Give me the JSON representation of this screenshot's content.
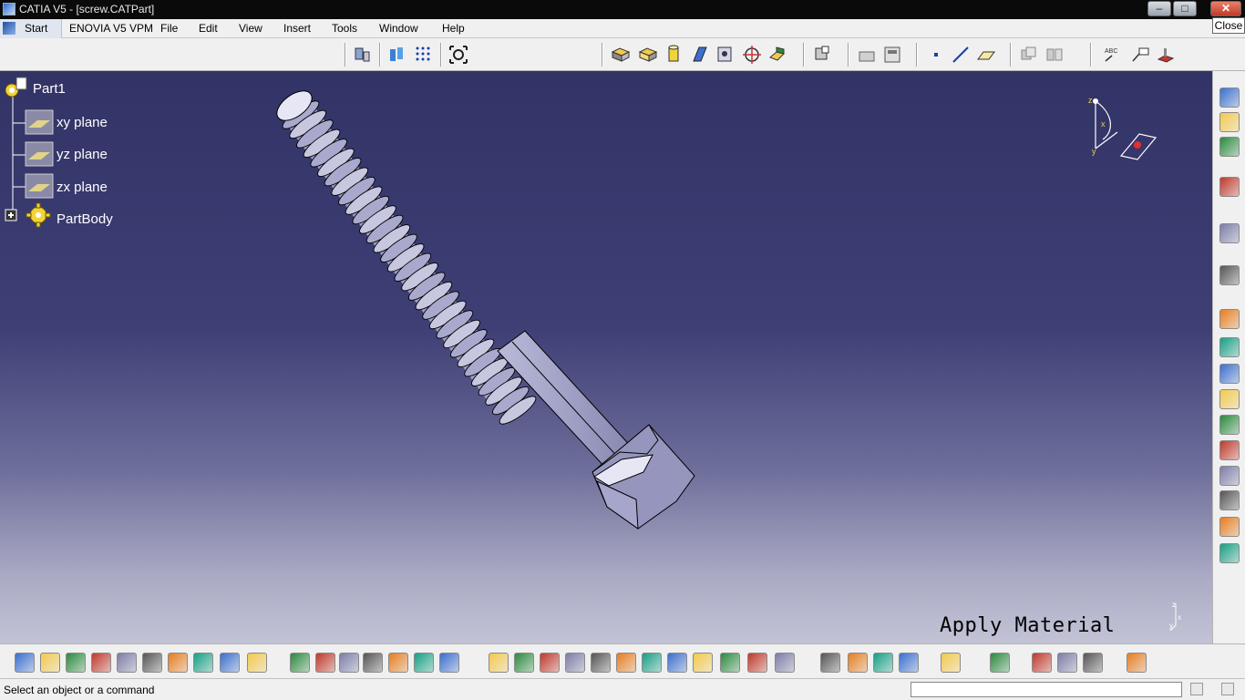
{
  "window": {
    "title": "CATIA V5 - [screw.CATPart]",
    "minimize_glyph": "–",
    "maximize_glyph": "□",
    "close_glyph": "✕",
    "close_tooltip": "Close"
  },
  "menu": {
    "start": "Start",
    "items": [
      "ENOVIA V5 VPM",
      "File",
      "Edit",
      "View",
      "Insert",
      "Tools",
      "Window",
      "Help"
    ]
  },
  "tree": {
    "root": "Part1",
    "planes": [
      "xy plane",
      "yz plane",
      "zx plane"
    ],
    "body": "PartBody"
  },
  "compass": {
    "z_label": "z",
    "x_label": "x",
    "y_label": "y"
  },
  "corner_axis": {
    "z_label": "z",
    "x_label": "x",
    "y_label": "y"
  },
  "viewport": {
    "overlay_text": "Apply Material",
    "bg_top": "#323366",
    "bg_bottom": "#c3c3d6",
    "part_color": "#9e9ec4"
  },
  "status": {
    "text": "Select an object or a command",
    "input_value": ""
  },
  "toolbars": {
    "top_icons": [
      "part-design-workbench-icon",
      "plane-manipulation-icon",
      "grid-icon",
      "fit-all-icon",
      "pad-icon",
      "pocket-icon",
      "shaft-icon",
      "rib-icon",
      "hole-icon",
      "groove-icon",
      "stiffener-icon",
      "thread-icon",
      "measure-icon",
      "tree-icon",
      "point-icon",
      "line-icon",
      "plane-icon",
      "boolean-icon",
      "symmetry-icon",
      "text-annotation-icon",
      "flag-note-icon",
      "material-icon"
    ],
    "right_icons": [
      "workbench-switch-icon",
      "product-icon",
      "assembly-icon",
      "gear-icon",
      "select-arrow-icon",
      "sketcher-icon",
      "pad-feature-icon",
      "pocket-feature-icon",
      "shaft-feature-icon",
      "groove-feature-icon",
      "hole-feature-icon",
      "rib-feature-icon",
      "slot-feature-icon",
      "stiffener-feature-icon",
      "loft-feature-icon",
      "remove-loft-icon"
    ],
    "bottom_icons": [
      "new-file-icon",
      "open-folder-icon",
      "save-icon",
      "print-icon",
      "cut-icon",
      "copy-icon",
      "paste-icon",
      "undo-icon",
      "redo-icon",
      "whats-this-icon",
      "formula-fx-icon",
      "knowledge-icon",
      "lightning-icon",
      "table-icon",
      "network-icon",
      "lock-icon",
      "catalog-icon",
      "fly-mode-icon",
      "fit-all-bottom-icon",
      "pan-icon",
      "rotate-icon",
      "zoom-in-icon",
      "zoom-out-icon",
      "normal-view-icon",
      "multi-view-icon",
      "iso-view-icon",
      "shading-icon",
      "hide-show-icon",
      "swap-visible-icon",
      "apply-material-icon",
      "render-icon",
      "photo-icon",
      "camera-icon",
      "measure-between-icon",
      "measure-item-icon",
      "measure-inertia-icon",
      "refresh-icon",
      "hand-icon",
      "catia-logo-icon"
    ]
  }
}
